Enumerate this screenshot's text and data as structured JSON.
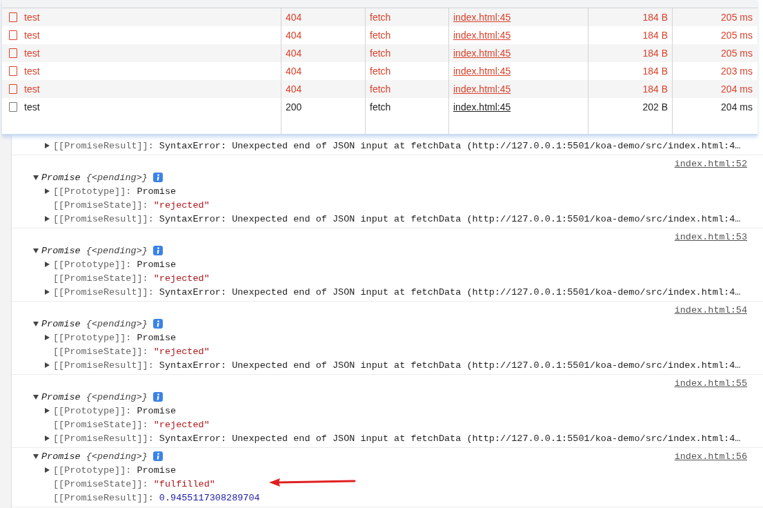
{
  "network": {
    "rows": [
      {
        "name": "test",
        "status": "404",
        "type": "fetch",
        "initiator": "index.html:45",
        "size": "184 B",
        "time": "205 ms",
        "failed": true
      },
      {
        "name": "test",
        "status": "404",
        "type": "fetch",
        "initiator": "index.html:45",
        "size": "184 B",
        "time": "205 ms",
        "failed": true
      },
      {
        "name": "test",
        "status": "404",
        "type": "fetch",
        "initiator": "index.html:45",
        "size": "184 B",
        "time": "205 ms",
        "failed": true
      },
      {
        "name": "test",
        "status": "404",
        "type": "fetch",
        "initiator": "index.html:45",
        "size": "184 B",
        "time": "203 ms",
        "failed": true
      },
      {
        "name": "test",
        "status": "404",
        "type": "fetch",
        "initiator": "index.html:45",
        "size": "184 B",
        "time": "204 ms",
        "failed": true
      },
      {
        "name": "test",
        "status": "200",
        "type": "fetch",
        "initiator": "index.html:45",
        "size": "202 B",
        "time": "204 ms",
        "failed": false
      }
    ]
  },
  "console": {
    "entries": [
      {
        "kind": "partial",
        "properties": [
          {
            "key": "[[PromiseResult]]:",
            "value": "SyntaxError: Unexpected end of JSON input at fetchData (http://127.0.0.1:5501/koa-demo/src/index.html:4…",
            "kind": "plain",
            "expandable": true
          }
        ]
      },
      {
        "kind": "stacked",
        "source": "index.html:52",
        "summary": "Promise",
        "preview": "{<pending>}",
        "expanded": true,
        "properties": [
          {
            "key": "[[Prototype]]:",
            "value": "Promise",
            "kind": "plain",
            "expandable": true
          },
          {
            "key": "[[PromiseState]]:",
            "value": "\"rejected\"",
            "kind": "string",
            "expandable": false
          },
          {
            "key": "[[PromiseResult]]:",
            "value": "SyntaxError: Unexpected end of JSON input at fetchData (http://127.0.0.1:5501/koa-demo/src/index.html:4…",
            "kind": "plain",
            "expandable": true
          }
        ]
      },
      {
        "kind": "stacked",
        "source": "index.html:53",
        "summary": "Promise",
        "preview": "{<pending>}",
        "expanded": true,
        "properties": [
          {
            "key": "[[Prototype]]:",
            "value": "Promise",
            "kind": "plain",
            "expandable": true
          },
          {
            "key": "[[PromiseState]]:",
            "value": "\"rejected\"",
            "kind": "string",
            "expandable": false
          },
          {
            "key": "[[PromiseResult]]:",
            "value": "SyntaxError: Unexpected end of JSON input at fetchData (http://127.0.0.1:5501/koa-demo/src/index.html:4…",
            "kind": "plain",
            "expandable": true
          }
        ]
      },
      {
        "kind": "stacked",
        "source": "index.html:54",
        "summary": "Promise",
        "preview": "{<pending>}",
        "expanded": true,
        "properties": [
          {
            "key": "[[Prototype]]:",
            "value": "Promise",
            "kind": "plain",
            "expandable": true
          },
          {
            "key": "[[PromiseState]]:",
            "value": "\"rejected\"",
            "kind": "string",
            "expandable": false
          },
          {
            "key": "[[PromiseResult]]:",
            "value": "SyntaxError: Unexpected end of JSON input at fetchData (http://127.0.0.1:5501/koa-demo/src/index.html:4…",
            "kind": "plain",
            "expandable": true
          }
        ]
      },
      {
        "kind": "stacked",
        "source": "index.html:55",
        "summary": "Promise",
        "preview": "{<pending>}",
        "expanded": true,
        "properties": [
          {
            "key": "[[Prototype]]:",
            "value": "Promise",
            "kind": "plain",
            "expandable": true
          },
          {
            "key": "[[PromiseState]]:",
            "value": "\"rejected\"",
            "kind": "string",
            "expandable": false
          },
          {
            "key": "[[PromiseResult]]:",
            "value": "SyntaxError: Unexpected end of JSON input at fetchData (http://127.0.0.1:5501/koa-demo/src/index.html:4…",
            "kind": "plain",
            "expandable": true
          }
        ]
      },
      {
        "kind": "inline",
        "source": "index.html:56",
        "summary": "Promise",
        "preview": "{<pending>}",
        "expanded": true,
        "properties": [
          {
            "key": "[[Prototype]]:",
            "value": "Promise",
            "kind": "plain",
            "expandable": true
          },
          {
            "key": "[[PromiseState]]:",
            "value": "\"fulfilled\"",
            "kind": "string",
            "expandable": false
          },
          {
            "key": "[[PromiseResult]]:",
            "value": "0.9455117308289704",
            "kind": "number",
            "expandable": false
          }
        ]
      }
    ]
  }
}
